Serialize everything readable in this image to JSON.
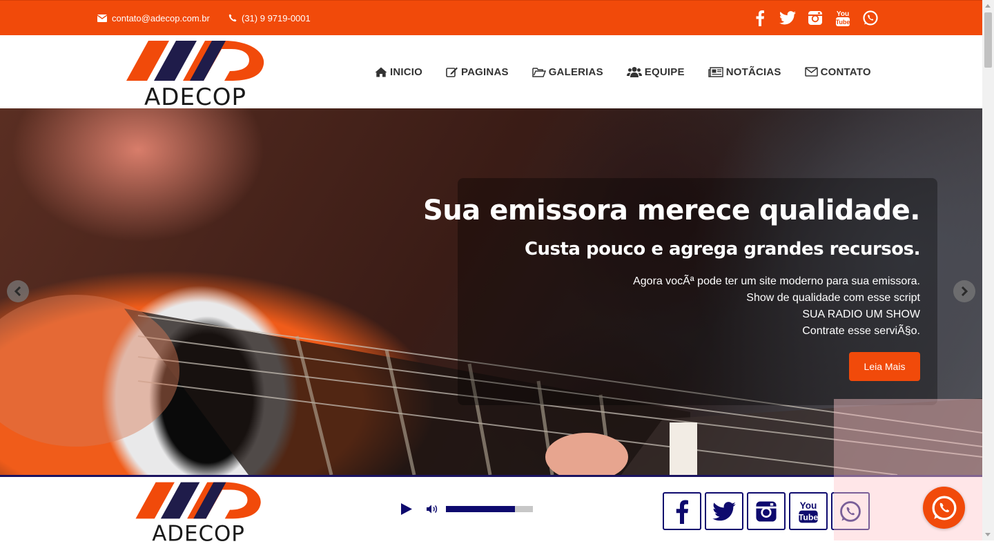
{
  "topbar": {
    "email": "contato@adecop.com.br",
    "phone": "(31) 9 9719-0001",
    "social_icons": [
      "facebook-icon",
      "twitter-icon",
      "instagram-icon",
      "youtube-icon",
      "whatsapp-icon"
    ],
    "background": "#f14a0a"
  },
  "header": {
    "logo_text": "ADECOP",
    "nav": [
      {
        "label": "INICIO",
        "icon": "home-icon"
      },
      {
        "label": "PAGINAS",
        "icon": "edit-icon"
      },
      {
        "label": "GALERIAS",
        "icon": "folder-icon"
      },
      {
        "label": "EQUIPE",
        "icon": "users-icon"
      },
      {
        "label": "NOTÃCIAS",
        "icon": "newspaper-icon"
      },
      {
        "label": "CONTATO",
        "icon": "envelope-icon"
      }
    ]
  },
  "slider": {
    "title": "Sua emissora merece qualidade.",
    "subtitle": "Custa pouco e agrega grandes recursos.",
    "lines": [
      "Agora vocÃª pode ter um site moderno para sua emissora.",
      "Show de qualidade com esse script",
      "SUA RADIO UM SHOW",
      "Contrate esse serviÃ§o."
    ],
    "button_label": "Leia Mais"
  },
  "player": {
    "logo_text": "ADECOP",
    "volume_level": 0.79,
    "social_icons": [
      "facebook-icon",
      "twitter-icon",
      "instagram-icon",
      "youtube-icon",
      "whatsapp-icon"
    ],
    "accent": "#0e0a6e"
  },
  "floating_button": {
    "icon": "whatsapp-icon",
    "color": "#f14a0a"
  }
}
